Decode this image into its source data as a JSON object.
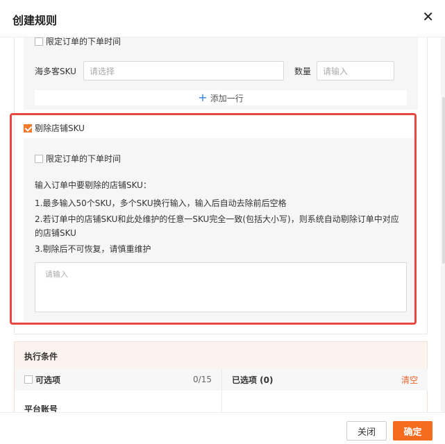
{
  "dialog": {
    "title": "创建规则",
    "close_symbol": "✕"
  },
  "section1": {
    "limit_time_label": "限定订单的下单时间",
    "sku_label": "海多客SKU",
    "sku_placeholder": "请选择",
    "qty_label": "数量",
    "qty_placeholder": "请输入",
    "add_row_label": "添加一行"
  },
  "remove_sku": {
    "checkbox_label": "剔除店铺SKU",
    "checked": true,
    "limit_time_label": "限定订单的下单时间",
    "instructions": [
      "输入订单中要剔除的店铺SKU：",
      "1.最多输入50个SKU，多个SKU换行输入，输入后自动去除前后空格",
      "2.若订单中的店铺SKU和此处维护的任意一SKU完全一致(包括大小写)，则系统自动剔除订单中对应的店铺SKU",
      "3.剔除后不可恢复，请慎重维护"
    ],
    "textarea_placeholder": "请输入"
  },
  "exec": {
    "title": "执行条件",
    "optional_label": "可选项",
    "optional_count": "0/15",
    "selected_label": "已选项 (0)",
    "clear_label": "清空",
    "platform_account_label": "平台账号"
  },
  "footer": {
    "close_label": "关闭",
    "ok_label": "确定"
  },
  "colors": {
    "accent": "#f56c1f",
    "highlight": "#e8473f",
    "link": "#2f7ed8"
  }
}
